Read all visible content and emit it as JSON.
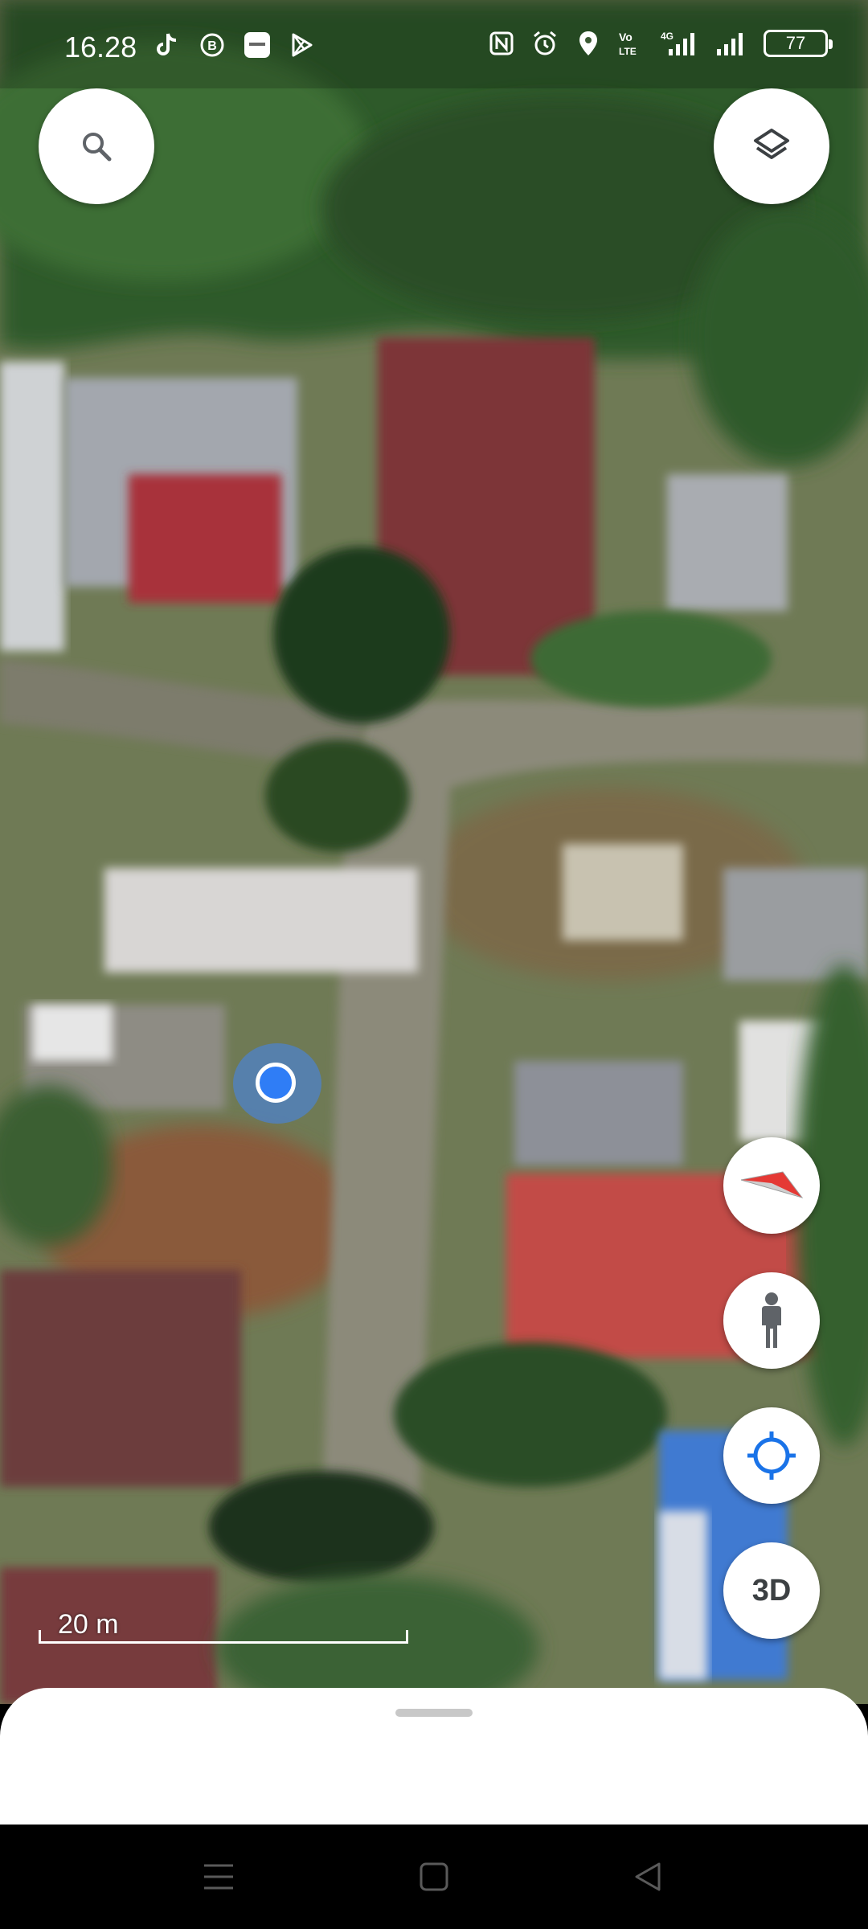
{
  "status_bar": {
    "time": "16.28",
    "left_icons": [
      "tiktok-icon",
      "b-circle-icon",
      "app-badge-icon",
      "play-store-icon"
    ],
    "right_icons": [
      "nfc-icon",
      "alarm-icon",
      "location-pin-icon",
      "volte-icon",
      "signal-4g-icon",
      "signal-icon"
    ],
    "battery_level": "77"
  },
  "map": {
    "type": "satellite",
    "scale_label": "20 m"
  },
  "controls": {
    "search": "search-icon",
    "layers": "layers-icon",
    "compass": "compass-icon",
    "street_view": "pegman-icon",
    "my_location": "my-location-icon",
    "three_d_label": "3D"
  },
  "bottom_sheet": {
    "handle": "drag-handle"
  },
  "nav_bar": {
    "buttons": [
      "menu-icon",
      "home-icon",
      "back-icon"
    ]
  },
  "colors": {
    "location_blue": "#2f7df6",
    "compass_red": "#e53935",
    "control_bg": "#ffffff"
  }
}
